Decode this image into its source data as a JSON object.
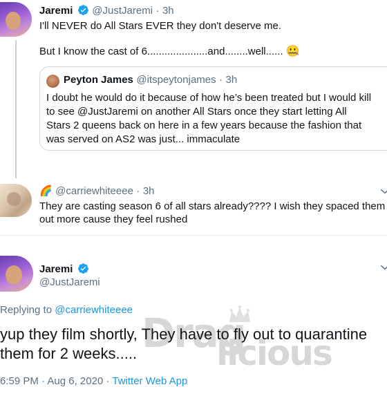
{
  "tweet1": {
    "name": "Jaremi",
    "handle": "@JustJaremi",
    "dot": "·",
    "time": "3h",
    "line1": "I'll NEVER do All Stars EVER they don't deserve me.",
    "line2": "But I know the cast of 6.....................and........well......",
    "emoji": "🤐"
  },
  "quote": {
    "name": "Peyton James",
    "handle": "@itspeytonjames",
    "dot": "·",
    "time": "3h",
    "lines": [
      "I doubt he would do it because of how he’s been treated but I would kill",
      "to see @JustJaremi on another All Stars once they start letting All",
      "Stars 2 queens back on here in a few years because the fashion that",
      "was served on AS2 was just... immaculate"
    ]
  },
  "tweet2": {
    "rainbow": "🌈",
    "handle": "@carriewhiteeee",
    "dot": "·",
    "time": "3h",
    "line1": "They are casting season 6 of all stars already???? I wish they spaced them",
    "line2": "out more cause they feel rushed"
  },
  "main": {
    "name": "Jaremi",
    "handle": "@JustJaremi",
    "replying_prefix": "Replying to",
    "replying_handle": "@carriewhiteeee",
    "line1": "yup they film shortly, They have to fly out to quarantine",
    "line2": "them for 2 weeks.....",
    "time": "6:59 PM",
    "date": "Aug 6, 2020",
    "source": "Twitter Web App",
    "dot": "·"
  },
  "watermark": {
    "top": "Drag",
    "bottom": "licious"
  },
  "colors": {
    "verified": "#1da1f2",
    "link": "#1b95e0",
    "muted": "#5b7083"
  }
}
